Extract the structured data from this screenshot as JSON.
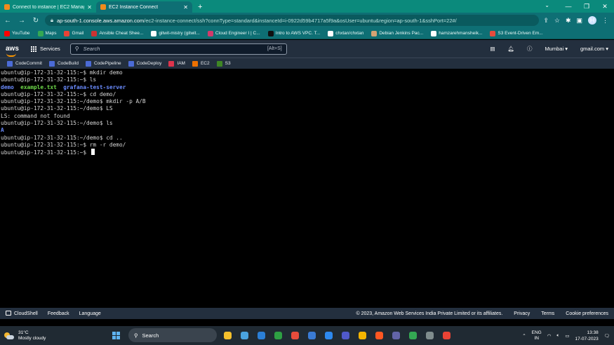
{
  "browser": {
    "tabs": [
      {
        "label": "Connect to instance | EC2 Manag",
        "active": false
      },
      {
        "label": "EC2 Instance Connect",
        "active": true
      }
    ],
    "url_host": "ap-south-1.console.aws.amazon.com",
    "url_path": "/ec2-instance-connect/ssh?connType=standard&instanceId=i-0922d59b4717a5f9a&osUser=ubuntu&region=ap-south-1&sshPort=22#/",
    "profile_initial": "H",
    "bookmarks": [
      {
        "label": "YouTube",
        "color": "#ff0000"
      },
      {
        "label": "Maps",
        "color": "#34a853"
      },
      {
        "label": "Gmail",
        "color": "#ea4335"
      },
      {
        "label": "Ansible Cheat Shee...",
        "color": "#cc3333"
      },
      {
        "label": "gitwit-mistry (gitwit...",
        "color": "#ffffff"
      },
      {
        "label": "Cloud Engineer I | C...",
        "color": "#d13a6b"
      },
      {
        "label": "Intro to AWS VPC. T...",
        "color": "#111111"
      },
      {
        "label": "chxtan/chxtan",
        "color": "#ffffff"
      },
      {
        "label": "Debian Jenkins Pac...",
        "color": "#d4a373"
      },
      {
        "label": "hamzarehmansheik...",
        "color": "#ffffff"
      },
      {
        "label": "S3 Event-Driven Em...",
        "color": "#e74c3c"
      }
    ]
  },
  "aws": {
    "logo": "aws",
    "services_label": "Services",
    "search_placeholder": "Search",
    "search_shortcut": "[Alt+S]",
    "region": "Mumbai ▾",
    "account": "gmail.com ▾",
    "favorites": [
      {
        "label": "CodeCommit",
        "color": "#4b6bd6"
      },
      {
        "label": "CodeBuild",
        "color": "#4b6bd6"
      },
      {
        "label": "CodePipeline",
        "color": "#4b6bd6"
      },
      {
        "label": "CodeDeploy",
        "color": "#4b6bd6"
      },
      {
        "label": "IAM",
        "color": "#dd344c"
      },
      {
        "label": "EC2",
        "color": "#ed7100"
      },
      {
        "label": "S3",
        "color": "#3f8624"
      }
    ]
  },
  "terminal": {
    "lines": [
      {
        "segments": [
          {
            "text": "ubuntu@ip-172-31-32-115:~$ mkdir demo",
            "style": "plain"
          }
        ]
      },
      {
        "segments": [
          {
            "text": "ubuntu@ip-172-31-32-115:~$ ls",
            "style": "plain"
          }
        ]
      },
      {
        "segments": [
          {
            "text": "demo",
            "style": "dir"
          },
          {
            "text": "  ",
            "style": "plain"
          },
          {
            "text": "example.txt",
            "style": "exec"
          },
          {
            "text": "  ",
            "style": "plain"
          },
          {
            "text": "grafana-test-server",
            "style": "dir"
          }
        ]
      },
      {
        "segments": [
          {
            "text": "ubuntu@ip-172-31-32-115:~$ cd demo/",
            "style": "plain"
          }
        ]
      },
      {
        "segments": [
          {
            "text": "ubuntu@ip-172-31-32-115:~/demo$ mkdir -p A/B",
            "style": "plain"
          }
        ]
      },
      {
        "segments": [
          {
            "text": "ubuntu@ip-172-31-32-115:~/demo$ LS",
            "style": "plain"
          }
        ]
      },
      {
        "segments": [
          {
            "text": "LS: command not found",
            "style": "plain"
          }
        ]
      },
      {
        "segments": [
          {
            "text": "ubuntu@ip-172-31-32-115:~/demo$ ls",
            "style": "plain"
          }
        ]
      },
      {
        "segments": [
          {
            "text": "A",
            "style": "dir"
          }
        ]
      },
      {
        "segments": [
          {
            "text": "ubuntu@ip-172-31-32-115:~/demo$ cd ..",
            "style": "plain"
          }
        ]
      },
      {
        "segments": [
          {
            "text": "ubuntu@ip-172-31-32-115:~$ rm -r demo/",
            "style": "plain"
          }
        ]
      },
      {
        "segments": [
          {
            "text": "ubuntu@ip-172-31-32-115:~$ ",
            "style": "plain"
          }
        ],
        "cursor": true
      }
    ]
  },
  "footer": {
    "cloudshell": "CloudShell",
    "feedback": "Feedback",
    "language": "Language",
    "copyright": "© 2023, Amazon Web Services India Private Limited or its affiliates.",
    "privacy": "Privacy",
    "terms": "Terms",
    "cookie": "Cookie preferences"
  },
  "taskbar": {
    "temp": "31°C",
    "weather": "Mostly cloudy",
    "search_label": "Search",
    "apps": [
      "#f5c02c",
      "#4aa3df",
      "#2b7fd6",
      "#2ea043",
      "#e74c3c",
      "#3a7bd5",
      "#2d89ef",
      "#5059c9",
      "#f4b400",
      "#ff5722",
      "#6264a7",
      "#34a853",
      "#7f8c8d",
      "#ea4335"
    ],
    "lang_line1": "ENG",
    "lang_line2": "IN",
    "time": "13:38",
    "date": "17-07-2023"
  }
}
